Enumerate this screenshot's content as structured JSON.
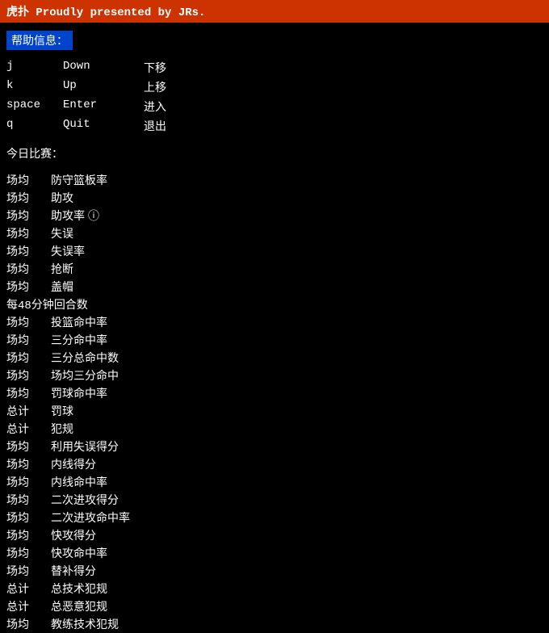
{
  "titleBar": {
    "text": "虎扑  Proudly presented by JRs."
  },
  "helpSection": {
    "label": "帮助信息：",
    "keys": [
      {
        "key": "j",
        "action": "Down",
        "desc": "下移"
      },
      {
        "key": "k",
        "action": "Up",
        "desc": "上移"
      },
      {
        "key": "space",
        "action": "Enter",
        "desc": "进入"
      },
      {
        "key": "q",
        "action": "Quit",
        "desc": "退出"
      }
    ]
  },
  "todayGames": {
    "label": "今日比赛：",
    "items": [
      {
        "prefix": "场均",
        "name": "防守篮板率",
        "hasIcon": false
      },
      {
        "prefix": "场均",
        "name": "助攻",
        "hasIcon": false
      },
      {
        "prefix": "场均",
        "name": "助攻率",
        "hasIcon": true
      },
      {
        "prefix": "场均",
        "name": "失误",
        "hasIcon": false
      },
      {
        "prefix": "场均",
        "name": "失误率",
        "hasIcon": false
      },
      {
        "prefix": "场均",
        "name": "抢断",
        "hasIcon": false
      },
      {
        "prefix": "场均",
        "name": "盖帽",
        "hasIcon": false
      },
      {
        "prefix": "每48分钟",
        "name": "回合数",
        "hasIcon": false
      },
      {
        "prefix": "场均",
        "name": "投篮命中率",
        "hasIcon": false
      },
      {
        "prefix": "场均",
        "name": "三分命中率",
        "hasIcon": false
      },
      {
        "prefix": "场均",
        "name": "三分总命中数",
        "hasIcon": false
      },
      {
        "prefix": "场均",
        "name": "场均三分命中",
        "hasIcon": false
      },
      {
        "prefix": "场均",
        "name": "罚球命中率",
        "hasIcon": false
      },
      {
        "prefix": "总计",
        "name": "罚球",
        "hasIcon": false
      },
      {
        "prefix": "总计",
        "name": "犯规",
        "hasIcon": false
      },
      {
        "prefix": "场均",
        "name": "利用失误得分",
        "hasIcon": false
      },
      {
        "prefix": "场均",
        "name": "内线得分",
        "hasIcon": false
      },
      {
        "prefix": "场均",
        "name": "内线命中率",
        "hasIcon": false
      },
      {
        "prefix": "场均",
        "name": "二次进攻得分",
        "hasIcon": false
      },
      {
        "prefix": "场均",
        "name": "二次进攻命中率",
        "hasIcon": false
      },
      {
        "prefix": "场均",
        "name": "快攻得分",
        "hasIcon": false
      },
      {
        "prefix": "场均",
        "name": "快攻命中率",
        "hasIcon": false
      },
      {
        "prefix": "场均",
        "name": "替补得分",
        "hasIcon": false
      },
      {
        "prefix": "总计",
        "name": "总技术犯规",
        "hasIcon": false
      },
      {
        "prefix": "总计",
        "name": "总恶意犯规",
        "hasIcon": false
      },
      {
        "prefix": "场均",
        "name": "教练技术犯规",
        "hasIcon": false
      }
    ]
  }
}
